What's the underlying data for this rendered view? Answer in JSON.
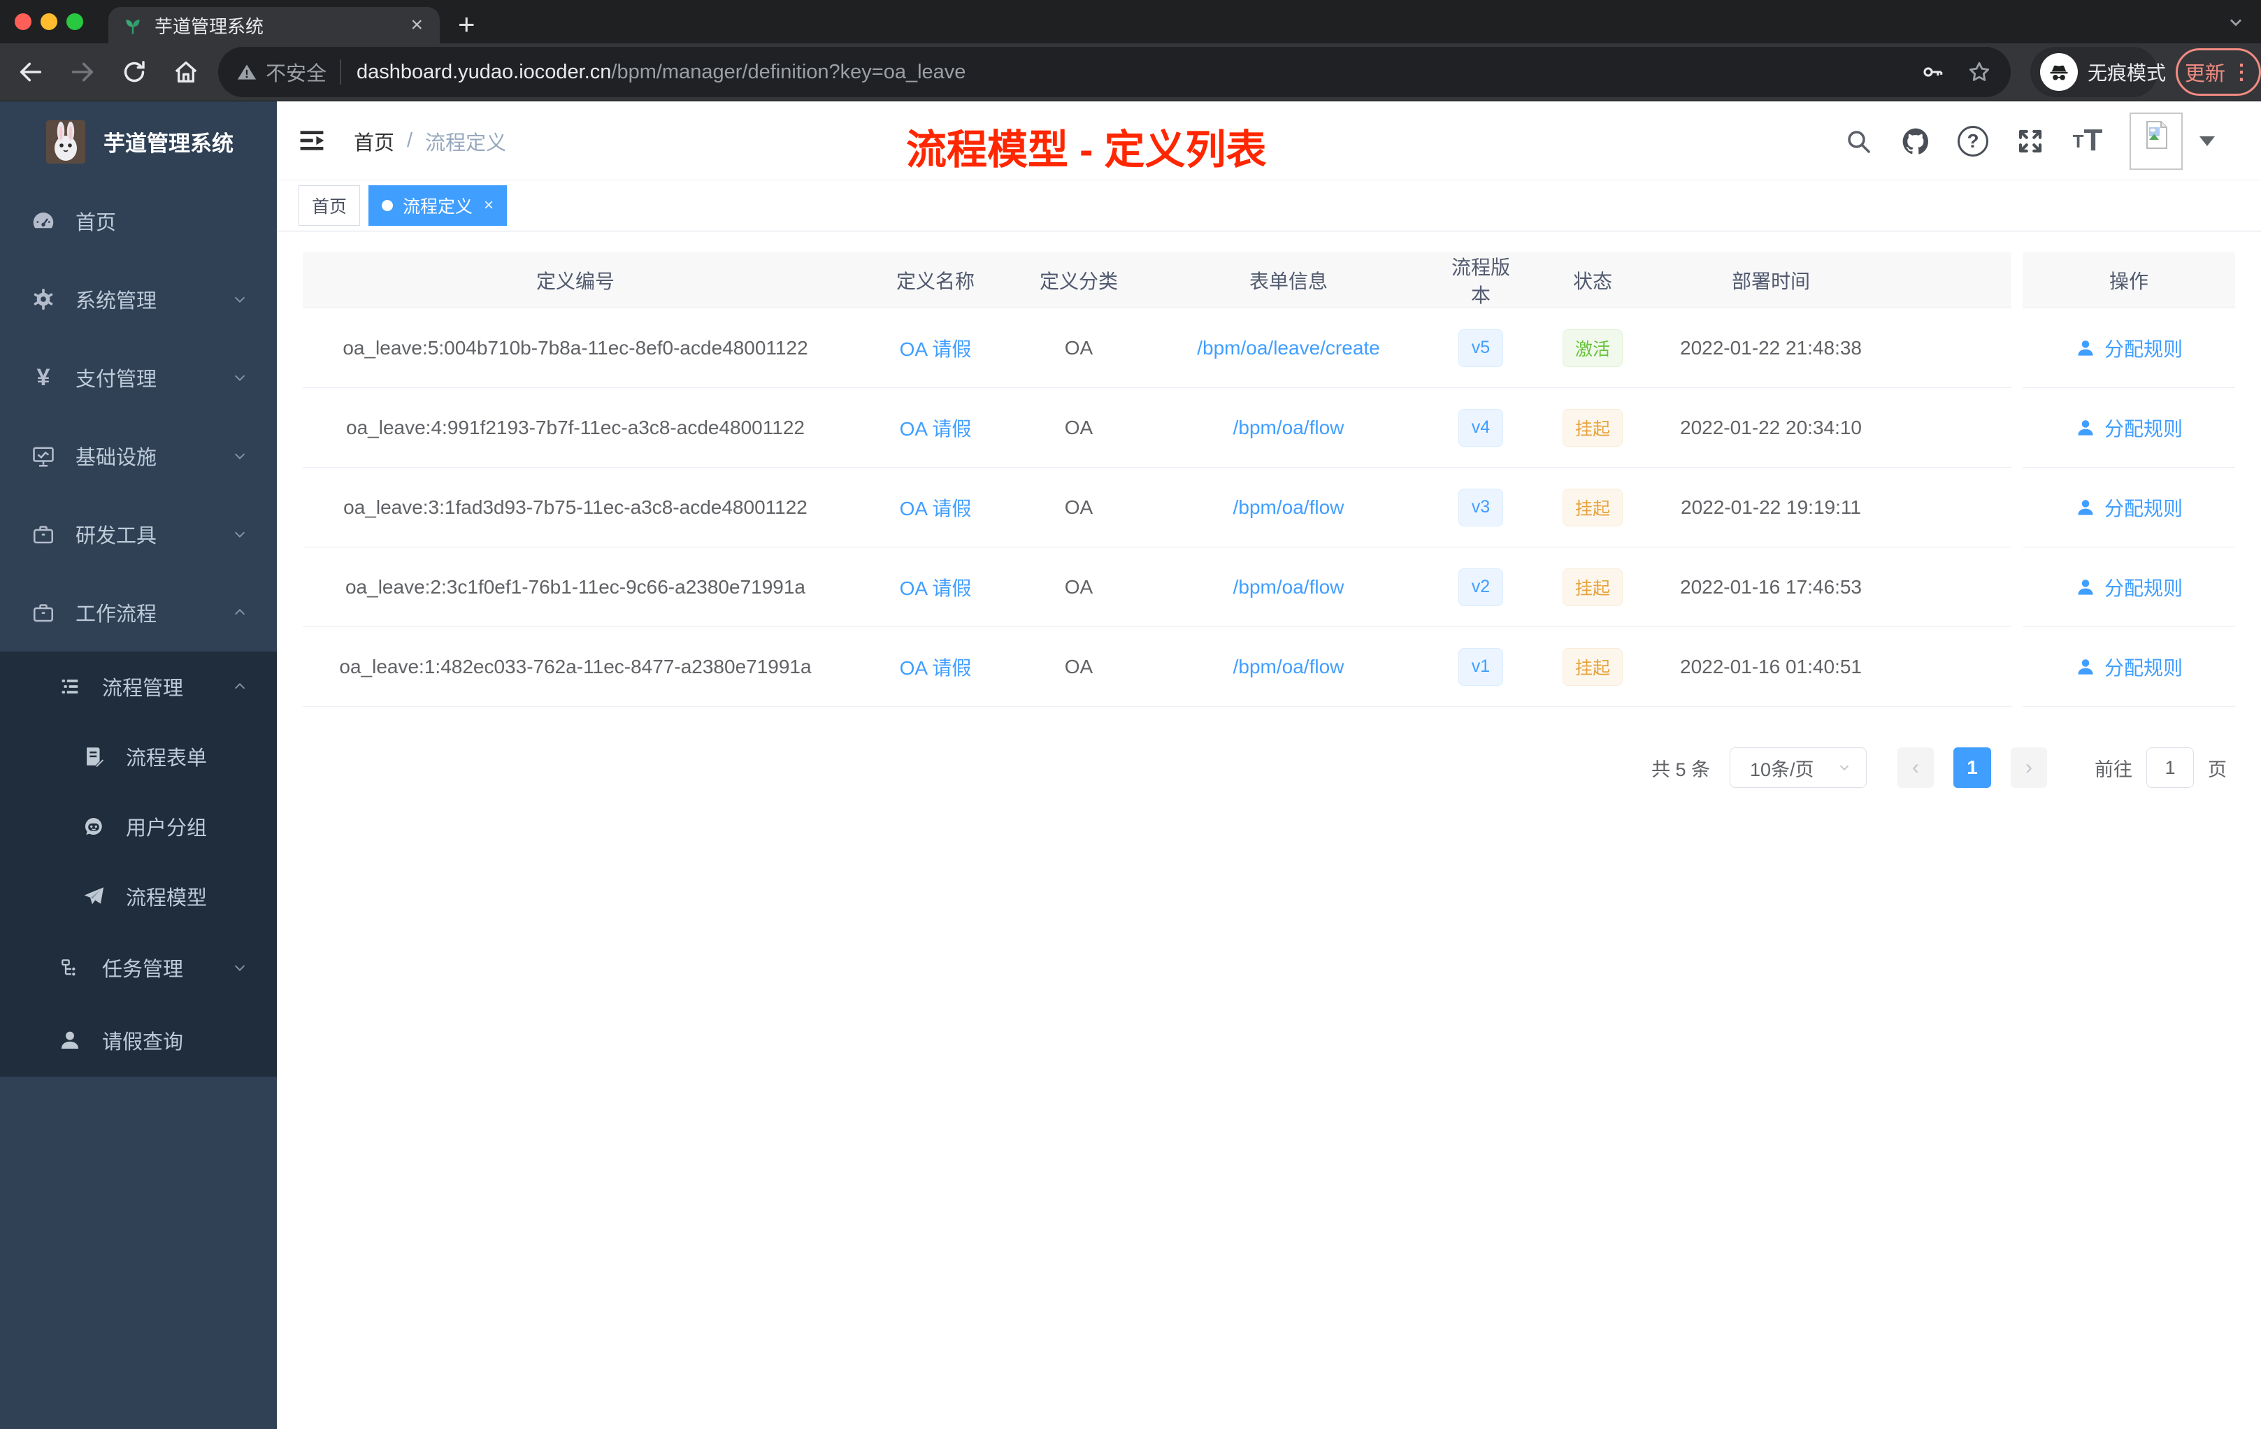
{
  "browser": {
    "tab_title": "芋道管理系统",
    "new_tab_glyph": "+",
    "security_label": "不安全",
    "url_host": "dashboard.yudao.iocoder.cn",
    "url_path": "/bpm/manager/definition?key=oa_leave",
    "incognito_label": "无痕模式",
    "update_label": "更新"
  },
  "sidebar": {
    "logo_title": "芋道管理系统",
    "items": [
      {
        "label": "首页",
        "icon": "dashboard"
      },
      {
        "label": "系统管理",
        "icon": "gear",
        "chevron": "down"
      },
      {
        "label": "支付管理",
        "icon": "yen",
        "chevron": "down"
      },
      {
        "label": "基础设施",
        "icon": "monitor",
        "chevron": "down"
      },
      {
        "label": "研发工具",
        "icon": "toolbox",
        "chevron": "down"
      },
      {
        "label": "工作流程",
        "icon": "briefcase",
        "chevron": "up"
      },
      {
        "label": "流程管理",
        "icon": "list",
        "chevron": "up"
      },
      {
        "label": "流程表单",
        "icon": "form-document"
      },
      {
        "label": "用户分组",
        "icon": "robot"
      },
      {
        "label": "流程模型",
        "icon": "paper-plane"
      },
      {
        "label": "任务管理",
        "icon": "org-tree",
        "chevron": "down"
      },
      {
        "label": "请假查询",
        "icon": "user"
      }
    ]
  },
  "header": {
    "breadcrumb": [
      "首页",
      "流程定义"
    ],
    "breadcrumb_separator": "/",
    "annotation": "流程模型 - 定义列表"
  },
  "tags": [
    {
      "label": "首页",
      "active": false
    },
    {
      "label": "流程定义",
      "active": true
    }
  ],
  "table": {
    "columns": [
      "定义编号",
      "定义名称",
      "定义分类",
      "表单信息",
      "流程版本",
      "状态",
      "部署时间",
      "操作"
    ],
    "rows": [
      {
        "id": "oa_leave:5:004b710b-7b8a-11ec-8ef0-acde48001122",
        "name": "OA 请假",
        "category": "OA",
        "form": "/bpm/oa/leave/create",
        "version": "v5",
        "status": "激活",
        "status_type": "success",
        "time": "2022-01-22 21:48:38",
        "action": "分配规则"
      },
      {
        "id": "oa_leave:4:991f2193-7b7f-11ec-a3c8-acde48001122",
        "name": "OA 请假",
        "category": "OA",
        "form": "/bpm/oa/flow",
        "version": "v4",
        "status": "挂起",
        "status_type": "warning",
        "time": "2022-01-22 20:34:10",
        "action": "分配规则"
      },
      {
        "id": "oa_leave:3:1fad3d93-7b75-11ec-a3c8-acde48001122",
        "name": "OA 请假",
        "category": "OA",
        "form": "/bpm/oa/flow",
        "version": "v3",
        "status": "挂起",
        "status_type": "warning",
        "time": "2022-01-22 19:19:11",
        "action": "分配规则"
      },
      {
        "id": "oa_leave:2:3c1f0ef1-76b1-11ec-9c66-a2380e71991a",
        "name": "OA 请假",
        "category": "OA",
        "form": "/bpm/oa/flow",
        "version": "v2",
        "status": "挂起",
        "status_type": "warning",
        "time": "2022-01-16 17:46:53",
        "action": "分配规则"
      },
      {
        "id": "oa_leave:1:482ec033-762a-11ec-8477-a2380e71991a",
        "name": "OA 请假",
        "category": "OA",
        "form": "/bpm/oa/flow",
        "version": "v1",
        "status": "挂起",
        "status_type": "warning",
        "time": "2022-01-16 01:40:51",
        "action": "分配规则"
      }
    ]
  },
  "pagination": {
    "total": "共 5 条",
    "page_size": "10条/页",
    "current": "1",
    "goto_label": "前往",
    "goto_value": "1",
    "page_unit": "页"
  },
  "colors": {
    "accent_blue": "#409eff",
    "success_green": "#67c23a",
    "warning_orange": "#e6a23c",
    "sidebar_bg": "#304156",
    "sidebar_submenu_bg": "#1f2d3d",
    "annotation_red": "#ff2600",
    "chrome_update_red": "#f28b82",
    "tag_active_bg": "#409eff"
  }
}
